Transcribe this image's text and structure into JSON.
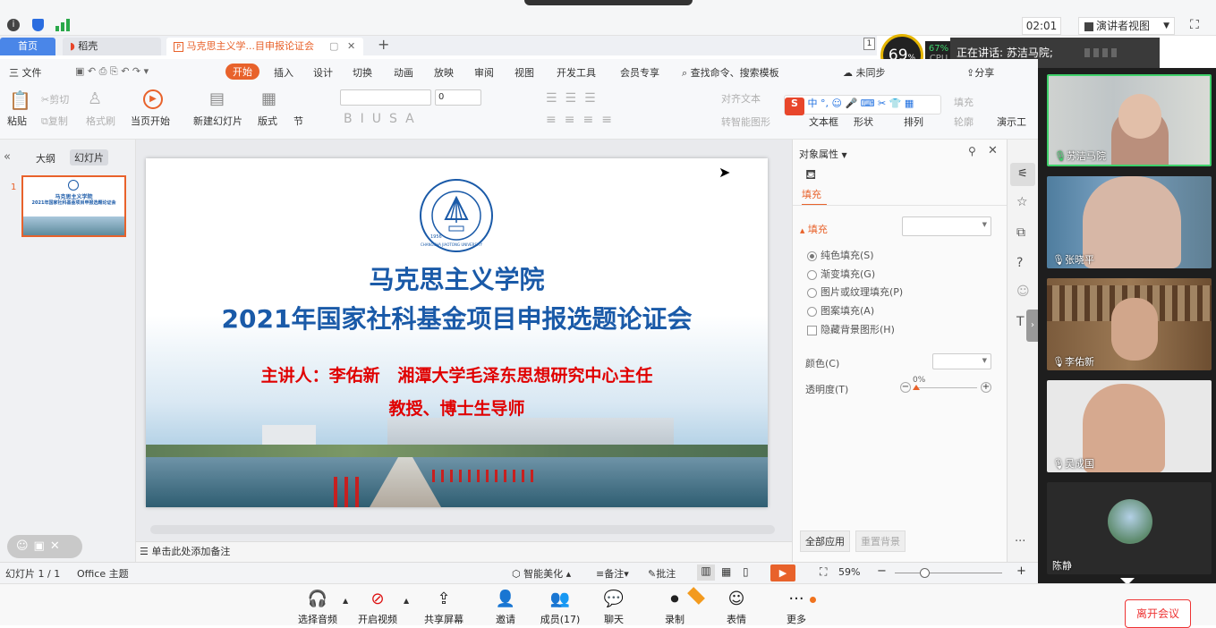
{
  "top": {
    "timer": "02:01",
    "presenter_view": "演讲者视图",
    "speaking": "正在讲话: 苏洁马院;",
    "cpu_big": "69",
    "cpu_pct": "%",
    "cpu_small": "67%",
    "cpu_label": "CPU"
  },
  "tabs": [
    {
      "label": "首页"
    },
    {
      "label": "稻壳"
    },
    {
      "label": "马克思主义学...目申报论证会"
    }
  ],
  "tab_count": "1",
  "menu": {
    "file": "三 文件",
    "items": [
      "开始",
      "插入",
      "设计",
      "切换",
      "动画",
      "放映",
      "审阅",
      "视图",
      "开发工具",
      "会员专享"
    ],
    "search": "查找命令、搜索模板",
    "sync": "未同步",
    "share": "分享"
  },
  "ribbon": {
    "paste": "粘贴",
    "cut": "剪切",
    "copy": "复制",
    "format_painter": "格式刷",
    "from_current": "当页开始",
    "new_slide": "新建幻灯片",
    "layout": "版式",
    "section": "节",
    "font_size": "0",
    "textbox": "文本框",
    "shape": "形状",
    "arrange": "排列",
    "outline": "轮廓",
    "fill": "填充",
    "to_text": "转智能图形",
    "text_box2": "对齐文本",
    "present": "演示工",
    "ime": [
      "中",
      "°,"
    ]
  },
  "left": {
    "outline": "大纲",
    "slides": "幻灯片",
    "slide_num": "1",
    "thumb_title1": "马克思主义学院",
    "thumb_title2": "2021年国家社科基金项目申报选题论证会"
  },
  "slide": {
    "title1": "马克思主义学院",
    "title2": "2021年国家社科基金项目申报选题论证会",
    "line1": "主讲人：李佑新   湘潭大学毛泽东思想研究中心主任",
    "line2": "教授、博士生导师",
    "logo_text": "CHANGSHA JIAOTONG UNIVERSITY",
    "logo_year": "1956"
  },
  "notes": "单击此处添加备注",
  "props": {
    "header": "对象属性",
    "tab": "填充",
    "section": "填充",
    "options": [
      "纯色填充(S)",
      "渐变填充(G)",
      "图片或纹理填充(P)",
      "图案填充(A)"
    ],
    "hide_bg": "隐藏背景图形(H)",
    "color": "颜色(C)",
    "transparency": "透明度(T)",
    "trans_val": "0%",
    "apply_all": "全部应用",
    "reset_bg": "重置背景"
  },
  "status": {
    "slide_info": "幻灯片 1 / 1",
    "theme": "Office 主题",
    "beautify": "智能美化",
    "notes": "备注",
    "comments": "批注",
    "zoom": "59%"
  },
  "participants": [
    {
      "name": "苏洁马院"
    },
    {
      "name": "张晓平"
    },
    {
      "name": "李佑新"
    },
    {
      "name": "吴成国"
    },
    {
      "name": "陈静"
    }
  ],
  "toolbar": [
    {
      "label": "选择音频"
    },
    {
      "label": "开启视频"
    },
    {
      "label": "共享屏幕"
    },
    {
      "label": "邀请"
    },
    {
      "label": "成员(17)"
    },
    {
      "label": "聊天"
    },
    {
      "label": "录制"
    },
    {
      "label": "表情"
    },
    {
      "label": "更多"
    }
  ],
  "leave": "离开会议",
  "colors": {
    "accent": "#e8622b",
    "title_blue": "#1a5aa8",
    "red": "#e00000"
  }
}
